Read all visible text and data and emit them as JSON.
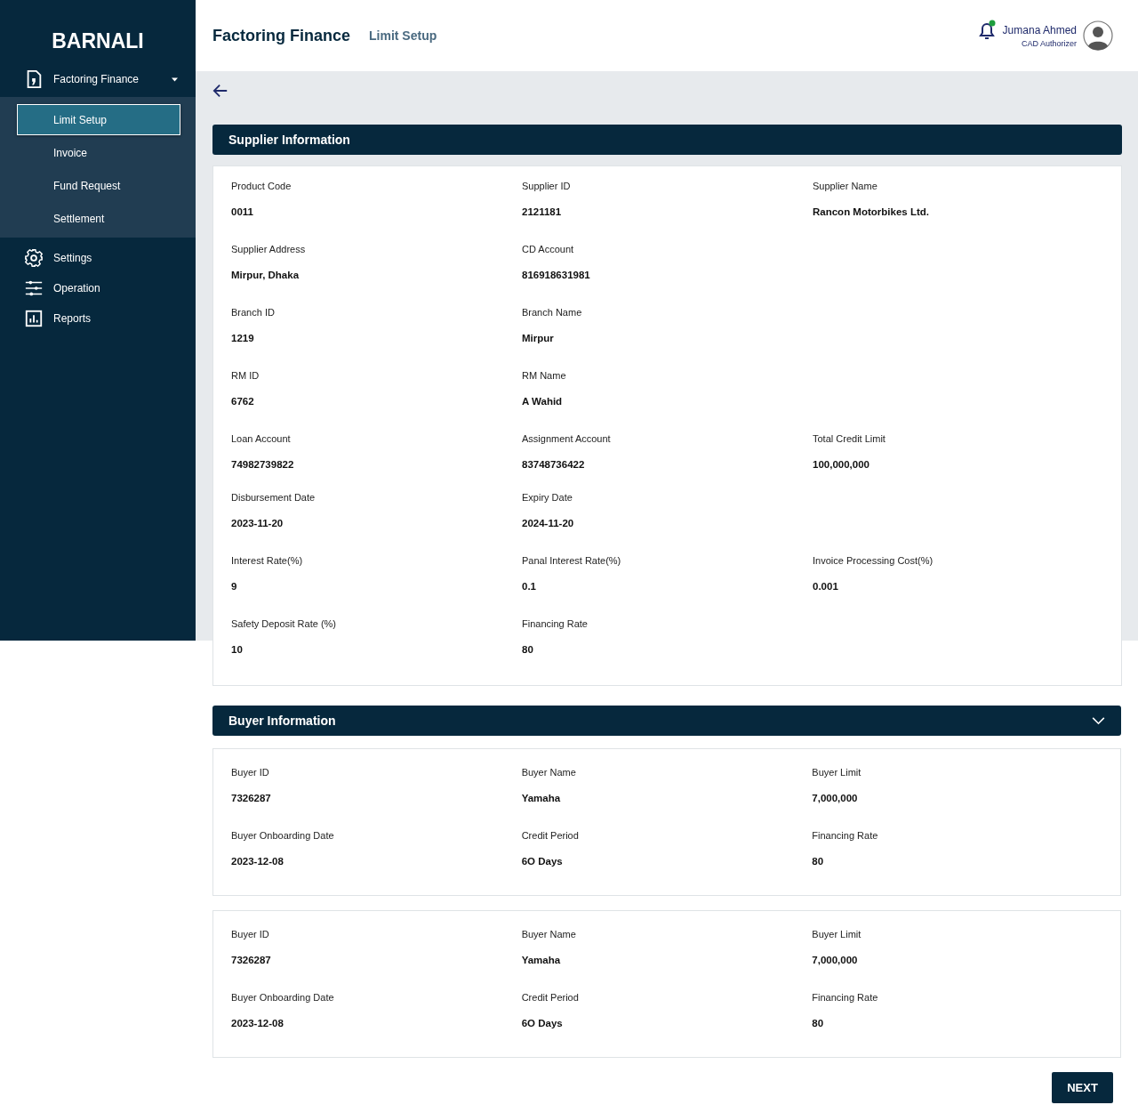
{
  "sidebar": {
    "logo": "BARNALI",
    "items": [
      {
        "label": "Factoring Finance",
        "expanded": true,
        "children": [
          {
            "label": "Limit Setup",
            "selected": true
          },
          {
            "label": "Invoice",
            "selected": false
          },
          {
            "label": "Fund Request",
            "selected": false
          },
          {
            "label": "Settlement",
            "selected": false
          }
        ]
      },
      {
        "label": "Settings"
      },
      {
        "label": "Operation"
      },
      {
        "label": "Reports"
      }
    ]
  },
  "header": {
    "title": "Factoring Finance",
    "subtitle": "Limit Setup",
    "notification": true,
    "user": {
      "name": "Jumana Ahmed",
      "role": "CAD Authorizer"
    }
  },
  "supplier": {
    "title": "Supplier Information",
    "rows": [
      [
        {
          "label": "Product Code",
          "value": "0011"
        },
        {
          "label": "Supplier ID",
          "value": "2121181"
        },
        {
          "label": "Supplier Name",
          "value": "Rancon Motorbikes Ltd."
        }
      ],
      [
        {
          "label": "Supplier Address",
          "value": "Mirpur, Dhaka"
        },
        {
          "label": "CD Account",
          "value": "816918631981"
        }
      ],
      [
        {
          "label": "Branch ID",
          "value": "1219"
        },
        {
          "label": "Branch Name",
          "value": "Mirpur"
        }
      ],
      [
        {
          "label": "RM ID",
          "value": "6762"
        },
        {
          "label": "RM Name",
          "value": "A Wahid"
        }
      ],
      [
        {
          "label": "Loan Account",
          "value": "74982739822"
        },
        {
          "label": "Assignment Account",
          "value": "83748736422"
        },
        {
          "label": "Total Credit Limit",
          "value": "100,000,000"
        }
      ],
      [
        {
          "label": "Disbursement Date",
          "value": "2023-11-20"
        },
        {
          "label": "Expiry Date",
          "value": "2024-11-20"
        }
      ],
      [
        {
          "label": "Interest Rate(%)",
          "value": "9"
        },
        {
          "label": "Panal Interest Rate(%)",
          "value": "0.1"
        },
        {
          "label": "Invoice Processing Cost(%)",
          "value": "0.001"
        }
      ],
      [
        {
          "label": "Safety Deposit Rate (%)",
          "value": "10"
        },
        {
          "label": "Financing Rate",
          "value": "80"
        }
      ]
    ]
  },
  "buyer": {
    "title": "Buyer Information",
    "expanded": true,
    "cards": [
      {
        "rows": [
          [
            {
              "label": "Buyer ID",
              "value": "7326287"
            },
            {
              "label": "Buyer Name",
              "value": "Yamaha"
            },
            {
              "label": "Buyer Limit",
              "value": "7,000,000"
            }
          ],
          [
            {
              "label": "Buyer Onboarding Date",
              "value": "2023-12-08"
            },
            {
              "label": "Credit Period",
              "value": "6O Days"
            },
            {
              "label": "Financing Rate",
              "value": "80"
            }
          ]
        ]
      },
      {
        "rows": [
          [
            {
              "label": "Buyer ID",
              "value": "7326287"
            },
            {
              "label": "Buyer Name",
              "value": "Yamaha"
            },
            {
              "label": "Buyer Limit",
              "value": "7,000,000"
            }
          ],
          [
            {
              "label": "Buyer Onboarding Date",
              "value": "2023-12-08"
            },
            {
              "label": "Credit Period",
              "value": "6O Days"
            },
            {
              "label": "Financing Rate",
              "value": "80"
            }
          ]
        ]
      }
    ]
  },
  "next_button": "NEXT"
}
